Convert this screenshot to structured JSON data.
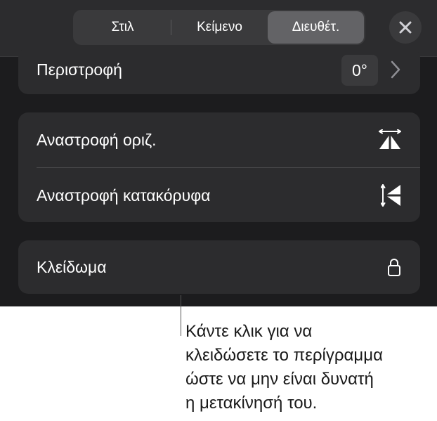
{
  "tabs": [
    {
      "label": "Στιλ",
      "selected": false
    },
    {
      "label": "Κείμενο",
      "selected": false
    },
    {
      "label": "Διευθέτ.",
      "selected": true
    }
  ],
  "close_icon": "close-icon",
  "rotation": {
    "label": "Περιστροφή",
    "value": "0°",
    "icon": "chevron-right-icon"
  },
  "flip": {
    "horizontal_label": "Αναστροφή οριζ.",
    "horizontal_icon": "flip-horizontal-icon",
    "vertical_label": "Αναστροφή κατακόρυφα",
    "vertical_icon": "flip-vertical-icon"
  },
  "lock": {
    "label": "Κλείδωμα",
    "icon": "lock-icon"
  },
  "callout": {
    "lines": [
      "Κάντε κλικ για να",
      "κλειδώσετε το περίγραμμα",
      "ώστε να μην είναι δυνατή",
      "η μετακίνησή του."
    ]
  },
  "colors": {
    "panel_bg": "#1c1c1e",
    "card_bg": "#2c2c2e",
    "selected_tab": "#636366",
    "text": "#ffffff"
  }
}
